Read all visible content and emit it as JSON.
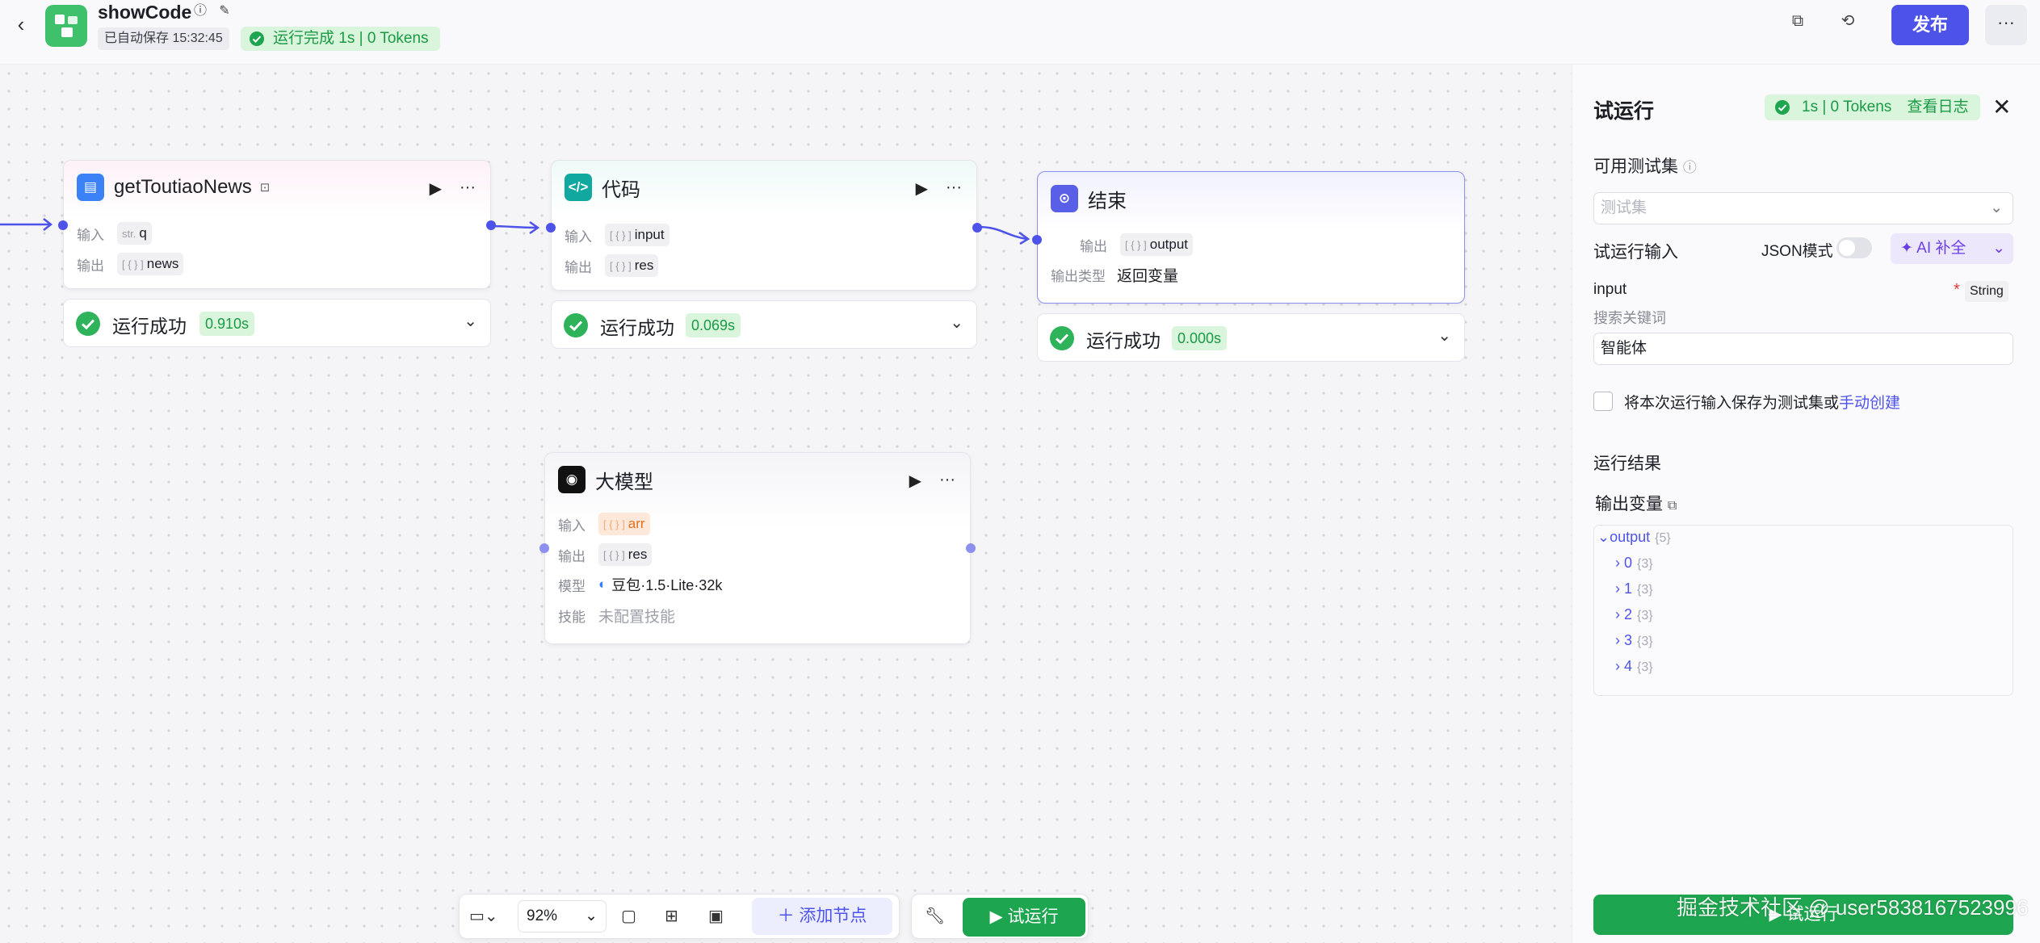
{
  "header": {
    "title": "showCode",
    "autosave": "已自动保存 15:32:45",
    "run_status": "运行完成 1s | 0 Tokens",
    "publish_label": "发布"
  },
  "nodes": {
    "news": {
      "title": "getToutiaoNews",
      "in_label": "输入",
      "in_type": "str.",
      "in_value": "q",
      "out_label": "输出",
      "out_type": "[ { } ]",
      "out_value": "news",
      "status": "运行成功",
      "time": "0.910s"
    },
    "code": {
      "title": "代码",
      "in_label": "输入",
      "in_type": "[ { } ]",
      "in_value": "input",
      "out_label": "输出",
      "out_type": "[ { } ]",
      "out_value": "res",
      "status": "运行成功",
      "time": "0.069s"
    },
    "end": {
      "title": "结束",
      "out_label": "输出",
      "out_type": "[ { } ]",
      "out_value": "output",
      "type_label": "输出类型",
      "type_value": "返回变量",
      "status": "运行成功",
      "time": "0.000s"
    },
    "llm": {
      "title": "大模型",
      "in_label": "输入",
      "in_type": "[ { } ]",
      "in_value": "arr",
      "out_label": "输出",
      "out_type": "[ { } ]",
      "out_value": "res",
      "model_label": "模型",
      "model_value": "豆包·1.5·Lite·32k",
      "skill_label": "技能",
      "skill_value": "未配置技能"
    }
  },
  "toolbar": {
    "zoom": "92%",
    "add_node": "添加节点",
    "trial_run": "试运行"
  },
  "panel": {
    "title": "试运行",
    "badge": "1s | 0 Tokens",
    "view_log": "查看日志",
    "testset_label": "可用测试集",
    "testset_placeholder": "测试集",
    "input_label": "试运行输入",
    "json_mode": "JSON模式",
    "ai_fill": "AI 补全",
    "field_name": "input",
    "field_required": "*",
    "field_type": "String",
    "field_hint": "搜索关键词",
    "field_value": "智能体",
    "save_prefix": "将本次运行输入保存为测试集或",
    "save_link": "手动创建",
    "result_label": "运行结果",
    "output_var_label": "输出变量",
    "tree": {
      "root": "output",
      "root_count": "{5}",
      "items": [
        {
          "key": "0",
          "count": "{3}"
        },
        {
          "key": "1",
          "count": "{3}"
        },
        {
          "key": "2",
          "count": "{3}"
        },
        {
          "key": "3",
          "count": "{3}"
        },
        {
          "key": "4",
          "count": "{3}"
        }
      ]
    },
    "run_button": "试运行"
  },
  "watermark": "掘金技术社区 @ user5838167523996",
  "colors": {
    "accent": "#4d53e8",
    "success": "#1ea54f",
    "success_bg": "#d9f5dc"
  }
}
